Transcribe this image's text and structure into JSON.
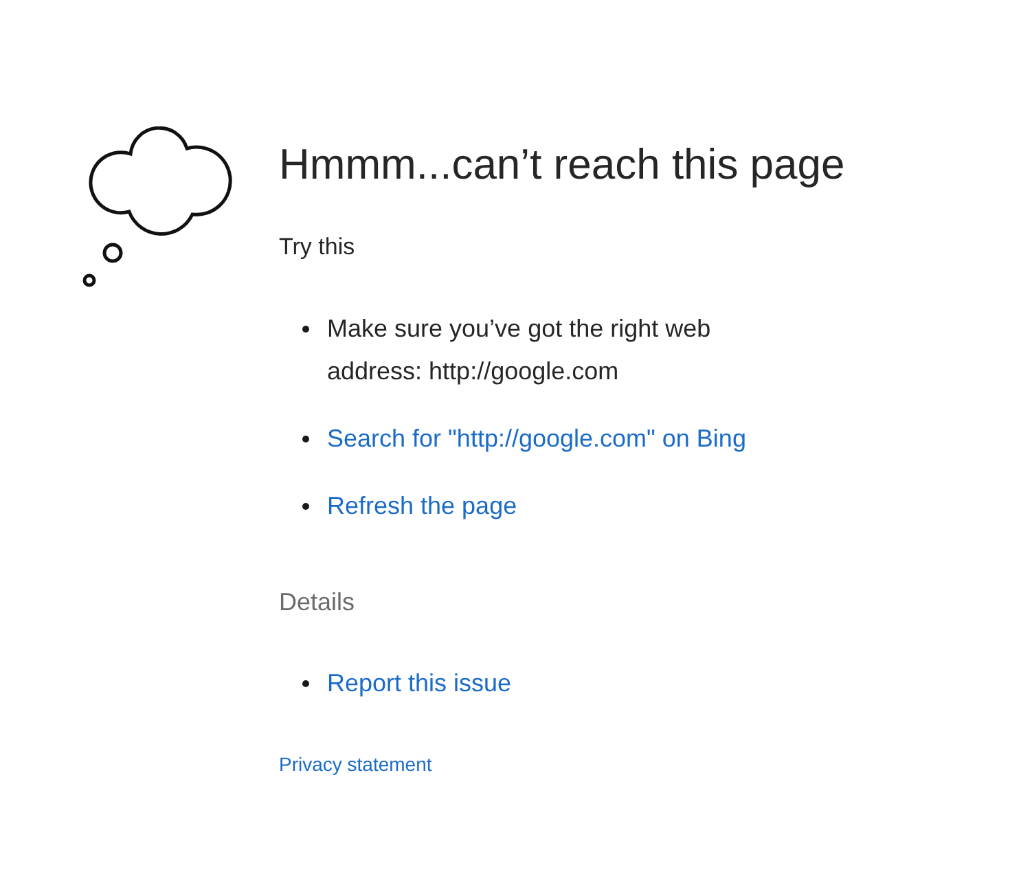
{
  "heading": "Hmmm...can’t reach this page",
  "subheading": "Try this",
  "suggestions": [
    {
      "kind": "text",
      "text": "Make sure you’ve got the right web address: http://google.com"
    },
    {
      "kind": "link",
      "text": "Search for \"http://google.com\" on Bing"
    },
    {
      "kind": "link",
      "text": "Refresh the page"
    }
  ],
  "details": {
    "heading": "Details",
    "items": [
      {
        "kind": "link",
        "text": "Report this issue"
      }
    ]
  },
  "footer_link": "Privacy statement"
}
